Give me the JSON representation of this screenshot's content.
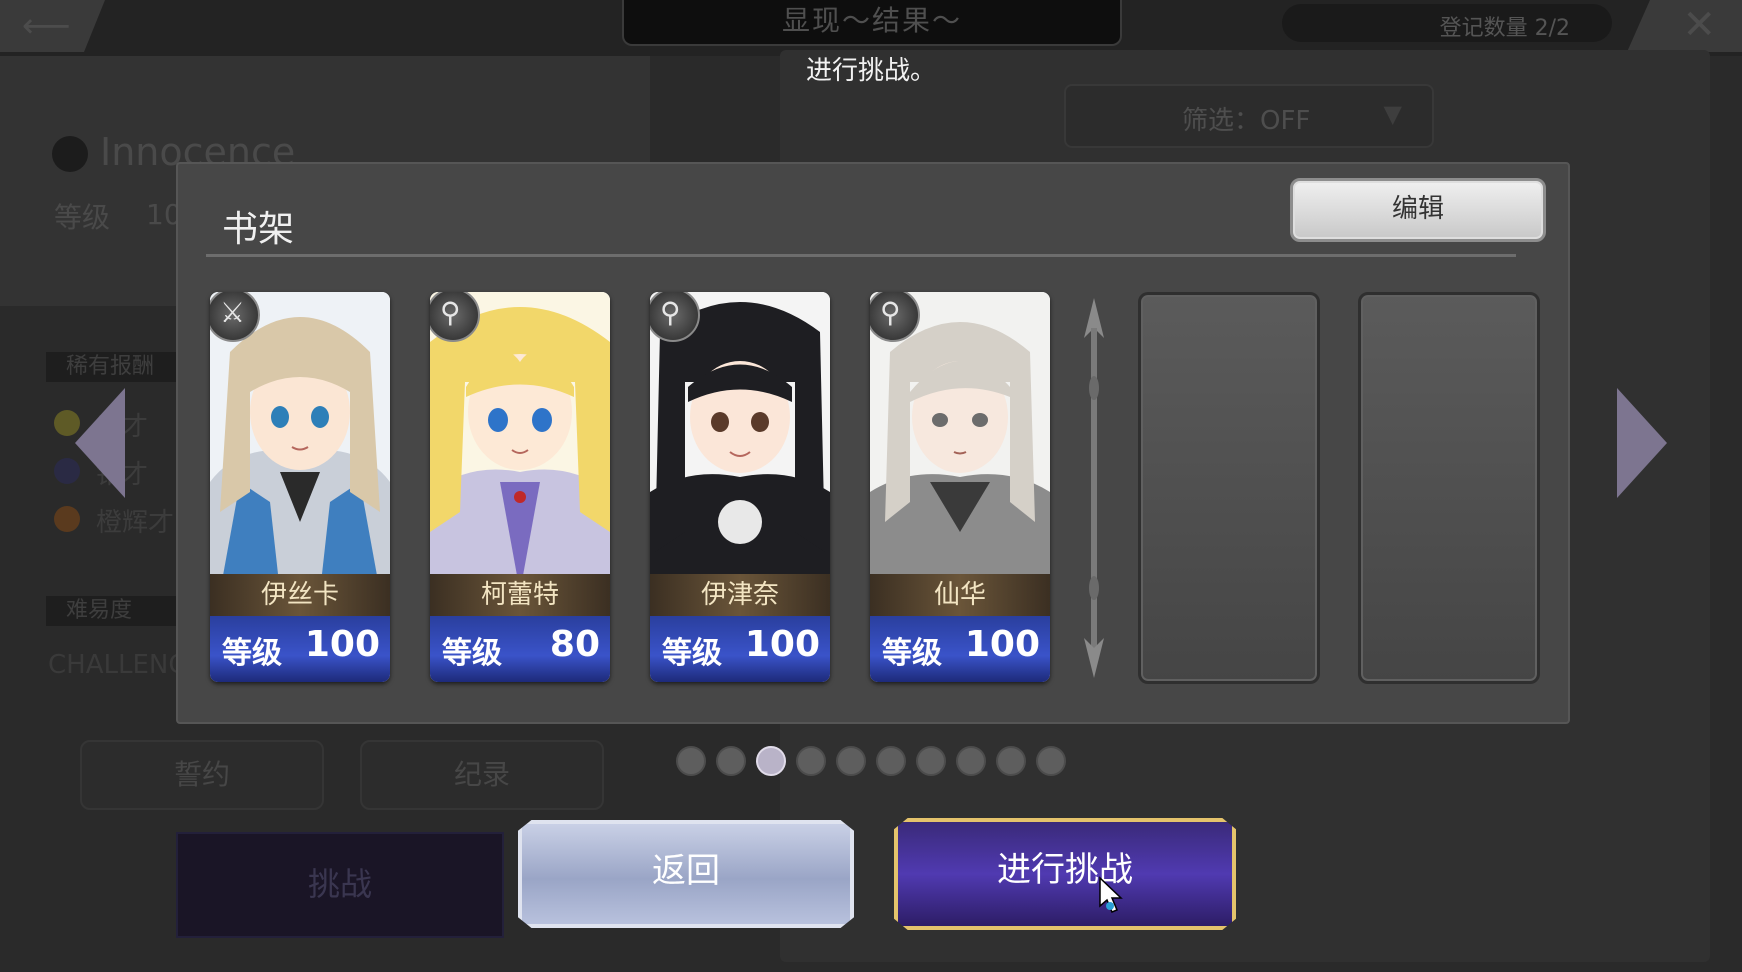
{
  "header": {
    "back_icon": "back-arrow-icon",
    "title": "显现～结果～",
    "count": "登记数量 2/2",
    "close_icon": "close-icon"
  },
  "subtitle": "进行挑战。",
  "background": {
    "character_name": "Innocence",
    "level_label": "等级",
    "level_value": "10",
    "filter": "筛选：OFF",
    "reward_header": "稀有报酬",
    "rewards": [
      "黄才",
      "铅才",
      "橙辉才"
    ],
    "difficulty_header": "难易度",
    "difficulty_value": "CHALLENG",
    "pact_label": "誓约",
    "record_label": "纪录",
    "challenge_label": "挑战"
  },
  "modal": {
    "title": "书架",
    "edit_label": "编辑",
    "cards": [
      {
        "name": "伊丝卡",
        "level_label": "等级",
        "level": "100",
        "class_icon": "sword-icon",
        "hair": "#d9c8a9",
        "eyes": "#2d7fb8"
      },
      {
        "name": "柯蕾特",
        "level_label": "等级",
        "level": "80",
        "class_icon": "staff-icon",
        "hair": "#f2d76a",
        "eyes": "#2e74c9"
      },
      {
        "name": "伊津奈",
        "level_label": "等级",
        "level": "100",
        "class_icon": "staff-icon",
        "hair": "#1e1e22",
        "eyes": "#5a3a2a"
      },
      {
        "name": "仙华",
        "level_label": "等级",
        "level": "100",
        "class_icon": "staff-icon",
        "hair": "#d5d0c8",
        "eyes": "#6c6c6c"
      }
    ],
    "empty_slots": 2
  },
  "pager": {
    "count": 10,
    "active": 2
  },
  "buttons": {
    "return_label": "返回",
    "go_label": "进行挑战"
  }
}
